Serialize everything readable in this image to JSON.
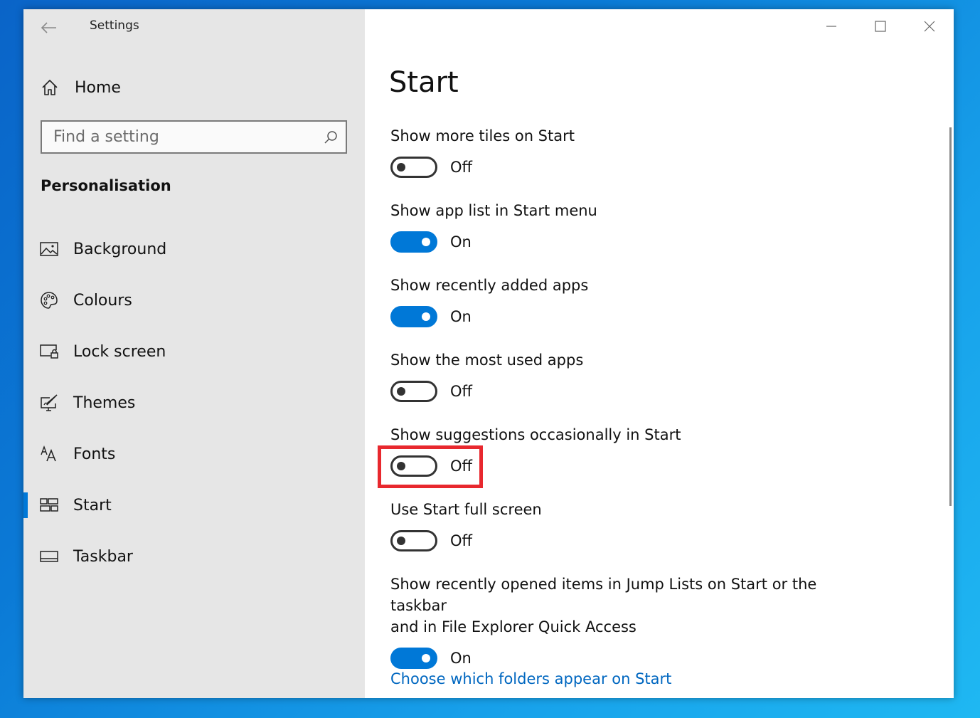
{
  "window": {
    "title": "Settings"
  },
  "sidebar": {
    "home_label": "Home",
    "search_placeholder": "Find a setting",
    "section_heading": "Personalisation",
    "items": [
      {
        "label": "Background",
        "icon": "picture-icon",
        "active": false
      },
      {
        "label": "Colours",
        "icon": "palette-icon",
        "active": false
      },
      {
        "label": "Lock screen",
        "icon": "lock-screen-icon",
        "active": false
      },
      {
        "label": "Themes",
        "icon": "themes-icon",
        "active": false
      },
      {
        "label": "Fonts",
        "icon": "fonts-icon",
        "active": false
      },
      {
        "label": "Start",
        "icon": "start-icon",
        "active": true
      },
      {
        "label": "Taskbar",
        "icon": "taskbar-icon",
        "active": false
      }
    ]
  },
  "main": {
    "page_title": "Start",
    "settings": [
      {
        "label": "Show more tiles on Start",
        "state": "Off"
      },
      {
        "label": "Show app list in Start menu",
        "state": "On"
      },
      {
        "label": "Show recently added apps",
        "state": "On"
      },
      {
        "label": "Show the most used apps",
        "state": "Off"
      },
      {
        "label": "Show suggestions occasionally in Start",
        "state": "Off"
      },
      {
        "label": "Use Start full screen",
        "state": "Off"
      },
      {
        "label": "Show recently opened items in Jump Lists on Start or the taskbar",
        "label_line2": "and in File Explorer Quick Access",
        "state": "On"
      }
    ],
    "link_text": "Choose which folders appear on Start"
  },
  "colors": {
    "accent": "#0078d7",
    "highlight": "#e8282e",
    "link": "#0067c0"
  }
}
